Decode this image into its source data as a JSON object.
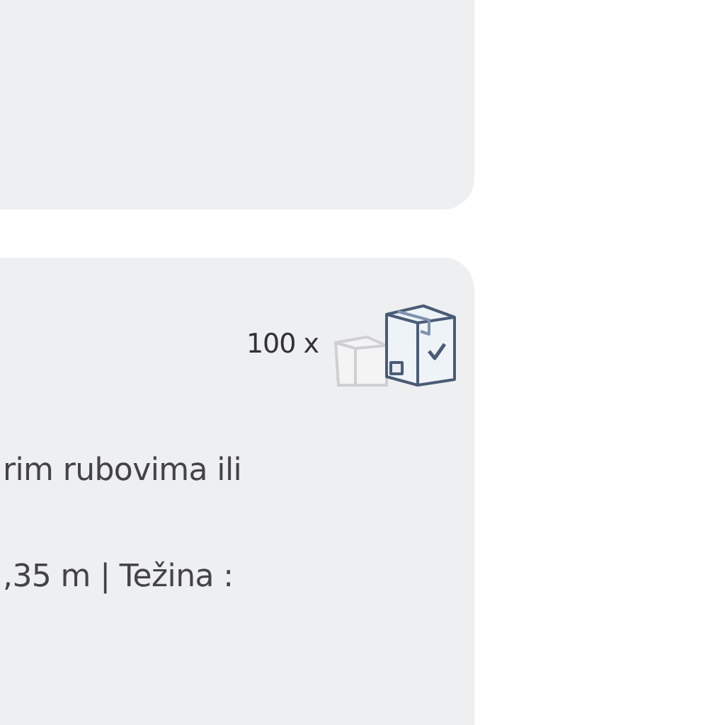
{
  "product_card": {
    "quantity": "100 x",
    "lines": [
      "rim rubovima ili",
      ",35 m | Težina :"
    ]
  }
}
